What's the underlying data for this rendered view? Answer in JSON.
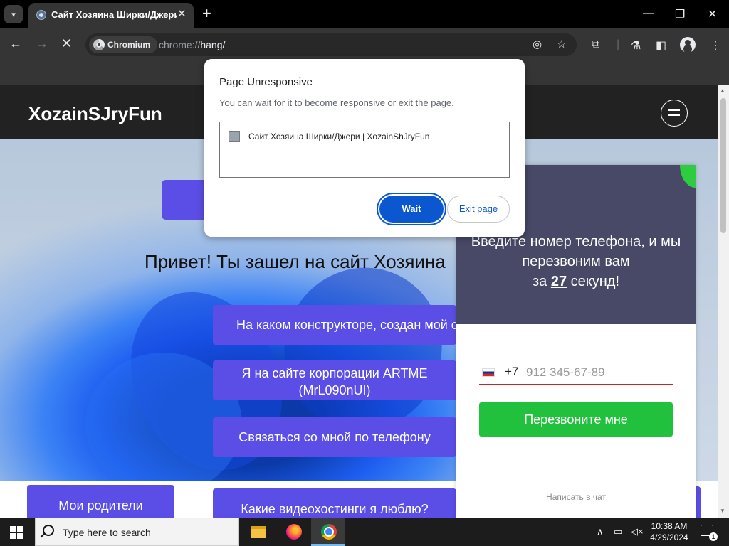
{
  "browser": {
    "tab": {
      "title": "Сайт Хозяина Ширки/Джери",
      "close": "✕"
    },
    "new_tab": "+",
    "window_controls": {
      "minimize": "—",
      "maximize": "❐",
      "close": "✕"
    },
    "nav": {
      "back": "←",
      "forward": "→",
      "stop": "✕"
    },
    "omnibox": {
      "chip": "Chromium",
      "url_scheme": "chrome://",
      "url_path": "hang/"
    }
  },
  "dialog": {
    "title": "Page Unresponsive",
    "message": "You can wait for it to become responsive or exit the page.",
    "pages": [
      "Сайт Хозяина Ширки/Джери | XozainShJryFun"
    ],
    "wait_label": "Wait",
    "exit_label": "Exit page"
  },
  "site": {
    "logo": "XozainSJryFun",
    "greeting": "Привет! Ты зашел на сайт Хозяина",
    "buttons": [
      "На каком конструкторе, создан мой с",
      "Я на сайте корпорации ARTME (MrL090nUI)",
      "Связаться со мной по телефону",
      "Мои родители",
      "Какие видеохостинги я люблю?"
    ]
  },
  "callback": {
    "line1": "Введите номер телефона, и мы перезвоним вам",
    "prefix": "за",
    "seconds": "27",
    "suffix": "секунд!",
    "country_code": "+7",
    "phone_placeholder": "912 345-67-89",
    "call_button": "Перезвоните мне",
    "chat_link": "Написать в чат"
  },
  "taskbar": {
    "search_placeholder": "Type here to search",
    "time": "10:38 AM",
    "date": "4/29/2024",
    "notification_count": "1"
  }
}
